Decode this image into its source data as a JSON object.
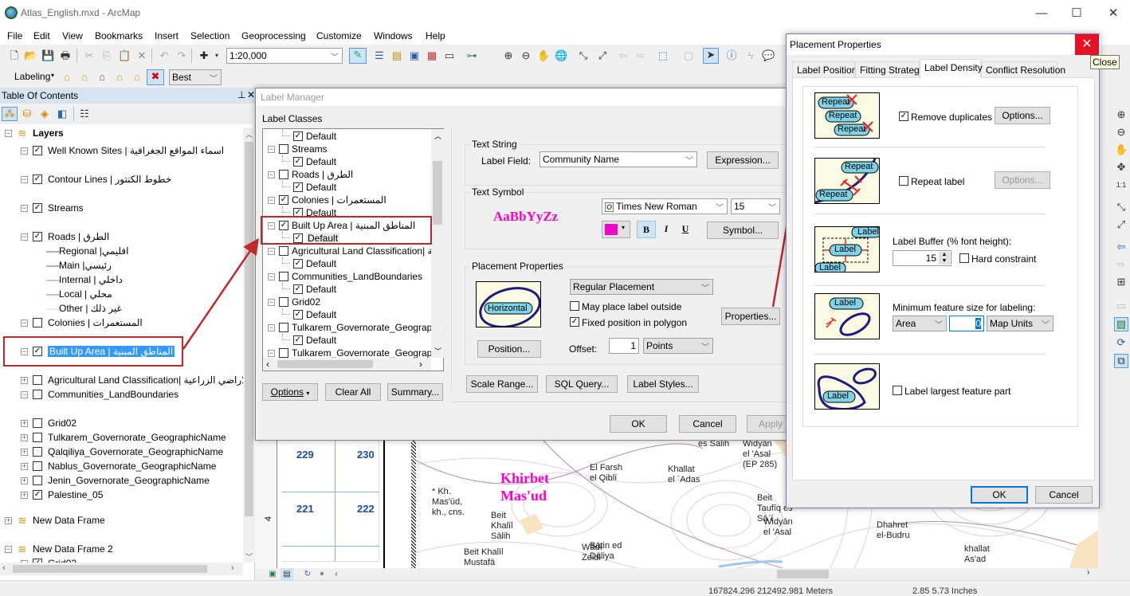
{
  "window": {
    "title": "Atlas_English.mxd - ArcMap",
    "controls": {
      "minimize": "—",
      "maximize": "☐",
      "close": "✕"
    }
  },
  "menubar": [
    "File",
    "Edit",
    "View",
    "Bookmarks",
    "Insert",
    "Selection",
    "Geoprocessing",
    "Customize",
    "Windows",
    "Help"
  ],
  "toolbar": {
    "scale": "1:20,000",
    "labeling_label": "Labeling",
    "labeling_mode": "Best"
  },
  "toc": {
    "title": "Table Of Contents",
    "root": "Layers",
    "layers": [
      {
        "name": "Well Known Sites | اسماء المواقع الجغرافية",
        "checked": true,
        "expanded": true
      },
      {
        "name": "Contour Lines | خطوط الكنتور",
        "checked": true,
        "expanded": true
      },
      {
        "name": "Streams",
        "checked": true,
        "expanded": true
      },
      {
        "name": "Roads | الطرق",
        "checked": true,
        "expanded": true,
        "legend": [
          "Regional |اقليمي",
          "Main |رئيسي",
          "Internal | داخلي",
          "Local | محلي",
          "Other | غير ذلك"
        ]
      },
      {
        "name": "Colonies | المستعمرات",
        "checked": false,
        "expanded": true
      },
      {
        "name": "Built Up Area |  المناطق المبنية",
        "checked": true,
        "expanded": true,
        "selected": true
      },
      {
        "name": "Agricultural Land Classification| الاراضي الزراعية",
        "checked": false,
        "expanded": false
      },
      {
        "name": "Communities_LandBoundaries",
        "checked": false,
        "expanded": true
      },
      {
        "name": "Grid02",
        "checked": false,
        "expanded": false
      },
      {
        "name": "Tulkarem_Governorate_GeographicName",
        "checked": false,
        "expanded": false
      },
      {
        "name": "Qalqiliya_Governorate_GeographicName",
        "checked": false,
        "expanded": false
      },
      {
        "name": "Nablus_Governorate_GeographicName",
        "checked": false,
        "expanded": false
      },
      {
        "name": "Jenin_Governorate_GeographicName",
        "checked": false,
        "expanded": false
      },
      {
        "name": "Palestine_05",
        "checked": true,
        "expanded": false
      }
    ],
    "frames": [
      {
        "name": "New Data Frame",
        "expanded": false
      },
      {
        "name": "New Data Frame 2",
        "expanded": true,
        "child": "Grid02",
        "child_checked": true
      }
    ]
  },
  "label_manager": {
    "title": "Label Manager",
    "classes_label": "Label Classes",
    "tree": [
      {
        "name": "Default",
        "level": 1,
        "checked": true
      },
      {
        "name": "Streams",
        "level": 0,
        "checked": false
      },
      {
        "name": "Default",
        "level": 1,
        "checked": true
      },
      {
        "name": "Roads | الطرق",
        "level": 0,
        "checked": false
      },
      {
        "name": "Default",
        "level": 1,
        "checked": true
      },
      {
        "name": "Colonies | المستعمرات",
        "level": 0,
        "checked": true
      },
      {
        "name": "Default",
        "level": 1,
        "checked": true
      },
      {
        "name": "Built Up Area |  المناطق المبنية",
        "level": 0,
        "checked": true
      },
      {
        "name": "Default",
        "level": 1,
        "checked": true,
        "selected": true
      },
      {
        "name": "Agricultural Land Classification| عية",
        "level": 0,
        "checked": false
      },
      {
        "name": "Default",
        "level": 1,
        "checked": true
      },
      {
        "name": "Communities_LandBoundaries",
        "level": 0,
        "checked": false
      },
      {
        "name": "Default",
        "level": 1,
        "checked": true
      },
      {
        "name": "Grid02",
        "level": 0,
        "checked": false
      },
      {
        "name": "Default",
        "level": 1,
        "checked": true
      },
      {
        "name": "Tulkarem_Governorate_Geographic",
        "level": 0,
        "checked": false
      },
      {
        "name": "Default",
        "level": 1,
        "checked": true
      },
      {
        "name": "Tulkarem_Governorate_Geographic",
        "level": 0,
        "checked": false
      }
    ],
    "options_btn": "Options",
    "clear_all_btn": "Clear All",
    "summary_btn": "Summary...",
    "text_string_group": "Text String",
    "label_field_label": "Label Field:",
    "label_field_value": "Community Name",
    "expression_btn": "Expression...",
    "text_symbol_group": "Text Symbol",
    "preview_text": "AaBbYyZz",
    "font_name": "Times New Roman",
    "font_size": "15",
    "text_color": "#ff00cc",
    "bold": "B",
    "italic": "I",
    "underline": "U",
    "symbol_btn": "Symbol...",
    "placement_group": "Placement Properties",
    "placement_preview": "Horizontal",
    "placement_type": "Regular Placement",
    "may_place_outside": "May place label outside",
    "may_place_outside_checked": false,
    "fixed_position": "Fixed position in polygon",
    "fixed_position_checked": true,
    "properties_btn": "Properties...",
    "position_btn": "Position...",
    "offset_label": "Offset:",
    "offset_value": "1",
    "offset_units": "Points",
    "scale_range_btn": "Scale Range...",
    "sql_query_btn": "SQL Query...",
    "label_styles_btn": "Label Styles...",
    "ok_btn": "OK",
    "cancel_btn": "Cancel",
    "apply_btn": "Apply"
  },
  "placement_props": {
    "title": "Placement Properties",
    "close_tooltip": "Close",
    "tabs": [
      "Label Position",
      "Fitting Strategy",
      "Label Density",
      "Conflict Resolution"
    ],
    "active_tab": "Label Density",
    "remove_duplicates": "Remove duplicates",
    "remove_duplicates_checked": true,
    "options_btn": "Options...",
    "repeat_label": "Repeat label",
    "repeat_label_checked": false,
    "repeat_options_btn": "Options...",
    "buffer_label": "Label Buffer (% font height):",
    "buffer_value": "15",
    "hard_constraint": "Hard constraint",
    "hard_constraint_checked": false,
    "min_size_label": "Minimum feature size for labeling:",
    "min_size_type": "Area",
    "min_size_value": "0",
    "min_size_units": "Map Units",
    "largest_part": "Label largest feature part",
    "largest_part_checked": false,
    "thumb_repeat": "Repeat",
    "thumb_label": "Label",
    "ok_btn": "OK",
    "cancel_btn": "Cancel"
  },
  "map": {
    "grid_numbers": [
      "229",
      "230",
      "221",
      "222"
    ],
    "ruler_mark": "4",
    "highlight_label": [
      "Khirbet",
      "Mas'ud"
    ],
    "labels": [
      {
        "text": "* Kh.\nMas'ūd,\nkh., cns."
      },
      {
        "text": "Beit\nKhalīl\nSālih"
      },
      {
        "text": "El Farsh\nel Qiblī"
      },
      {
        "text": "Khallat\nel `Adas"
      },
      {
        "text": "es Salih"
      },
      {
        "text": "Widyān\nel 'Asal\n(EP 285)"
      },
      {
        "text": "Beit\nTaufīq es\nSāʾī"
      },
      {
        "text": "Wādī\nZeidi"
      },
      {
        "text": "Bātin ed\nDāliya"
      },
      {
        "text": "Beit Khalīl\nMustafā"
      },
      {
        "text": "Widyān\nel 'Asal"
      },
      {
        "text": "Dhahret\nel-Budru"
      },
      {
        "text": "khallat\nAs'ad"
      }
    ]
  },
  "status": {
    "coords": "167824.296  212492.981 Meters",
    "page_coords": "2.85  5.73 Inches"
  }
}
